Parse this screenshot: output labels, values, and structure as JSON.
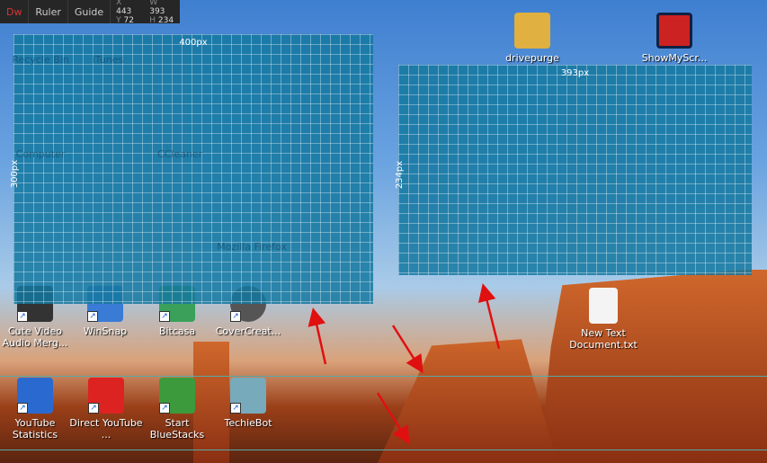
{
  "toolbar": {
    "logo": "Dw",
    "ruler": "Ruler",
    "guide": "Guide",
    "x_label": "X",
    "x": "443",
    "y_label": "Y",
    "y": "72",
    "w_label": "W",
    "w": "393",
    "h_label": "H",
    "h": "234"
  },
  "overlays": [
    {
      "width_label": "400px",
      "height_label": "300px"
    },
    {
      "width_label": "393px",
      "height_label": "234px"
    }
  ],
  "obscured_icons": [
    "Recycle Bin",
    "iTunes",
    "Computer",
    "CCleaner",
    "Mozilla Firefox"
  ],
  "icons": [
    {
      "label": "Cute Video Audio Merg...",
      "color": "#333"
    },
    {
      "label": "WinSnap",
      "color": "#3a7bd5"
    },
    {
      "label": "Bitcasa",
      "color": "#3aa05a"
    },
    {
      "label": "CoverCreat...",
      "color": "#555"
    },
    {
      "label": "YouTube Statistics",
      "color": "#2a6ad0"
    },
    {
      "label": "Direct YouTube ...",
      "color": "#d22"
    },
    {
      "label": "Start BlueStacks",
      "color": "#3c9a3c"
    },
    {
      "label": "TechieBot",
      "color": "#7ab"
    },
    {
      "label": "drivepurge",
      "color": "#e0b040"
    },
    {
      "label": "ShowMyScr...",
      "color": "#c22"
    },
    {
      "label": "New Text Document.txt",
      "color": "#f4f4f4"
    }
  ]
}
